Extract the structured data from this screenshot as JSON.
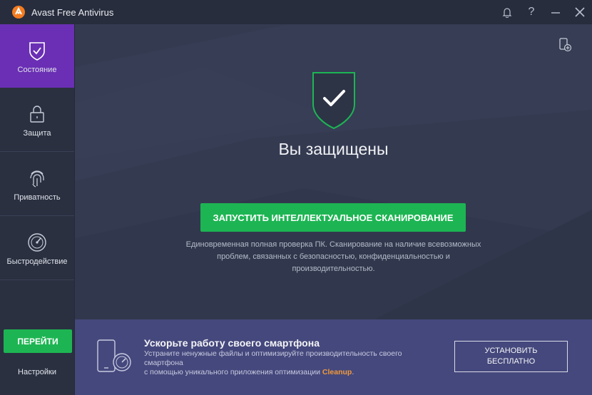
{
  "window": {
    "title": "Avast Free Antivirus"
  },
  "titlebar": {
    "notifications_icon": "bell-icon",
    "help_label": "?",
    "minimize_icon": "minimize-icon",
    "close_icon": "close-icon"
  },
  "sidebar": {
    "items": [
      {
        "label": "Состояние",
        "icon": "shield-check-icon",
        "active": true
      },
      {
        "label": "Защита",
        "icon": "lock-icon"
      },
      {
        "label": "Приватность",
        "icon": "fingerprint-icon"
      },
      {
        "label": "Быстродействие",
        "icon": "speedometer-icon"
      }
    ],
    "go_label": "ПЕРЕЙТИ",
    "settings_label": "Настройки"
  },
  "main": {
    "status_title": "Вы защищены",
    "scan_button_label": "ЗАПУСТИТЬ ИНТЕЛЛЕКТУАЛЬНОЕ СКАНИРОВАНИЕ",
    "description_line1": "Единовременная полная проверка ПК. Сканирование на наличие всевозможных",
    "description_line2": "проблем, связанных с безопасностью, конфиденциальностью и",
    "description_line3": "производительностью."
  },
  "promo": {
    "title": "Ускорьте работу своего смартфона",
    "text_line1": "Устраните ненужные файлы и оптимизируйте производительность своего",
    "text_line2": "смартфона",
    "text_line3": "с помощью уникального приложения оптимизации ",
    "app_name": "Cleanup",
    "text_suffix": ".",
    "install_line1": "УСТАНОВИТЬ",
    "install_line2": "БЕСПЛАТНО"
  },
  "colors": {
    "accent_purple": "#6a2fb4",
    "accent_green": "#1db553",
    "promo_bg": "#45487c",
    "cleanup_orange": "#f09a3a"
  }
}
